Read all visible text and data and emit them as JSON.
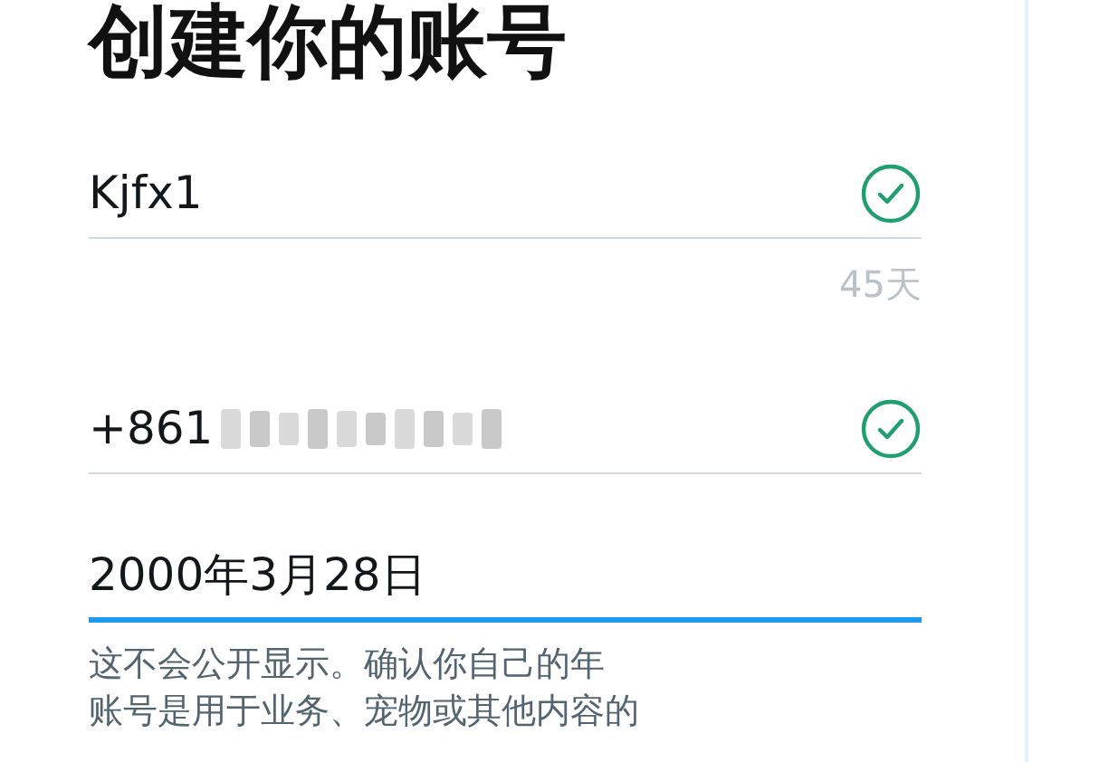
{
  "title": "创建你的账号",
  "fields": [
    {
      "kind": "name",
      "value": "Kjfx1",
      "valid": true,
      "counter": "45天",
      "focused": false
    },
    {
      "kind": "phone",
      "value": "+861",
      "valid": true,
      "focused": false
    },
    {
      "kind": "date",
      "value": "2000年3月28日",
      "focused": true
    }
  ],
  "hint_lines": [
    "这不会公开显示。确认你自己的年",
    "账号是用于业务、宠物或其他内容的"
  ]
}
